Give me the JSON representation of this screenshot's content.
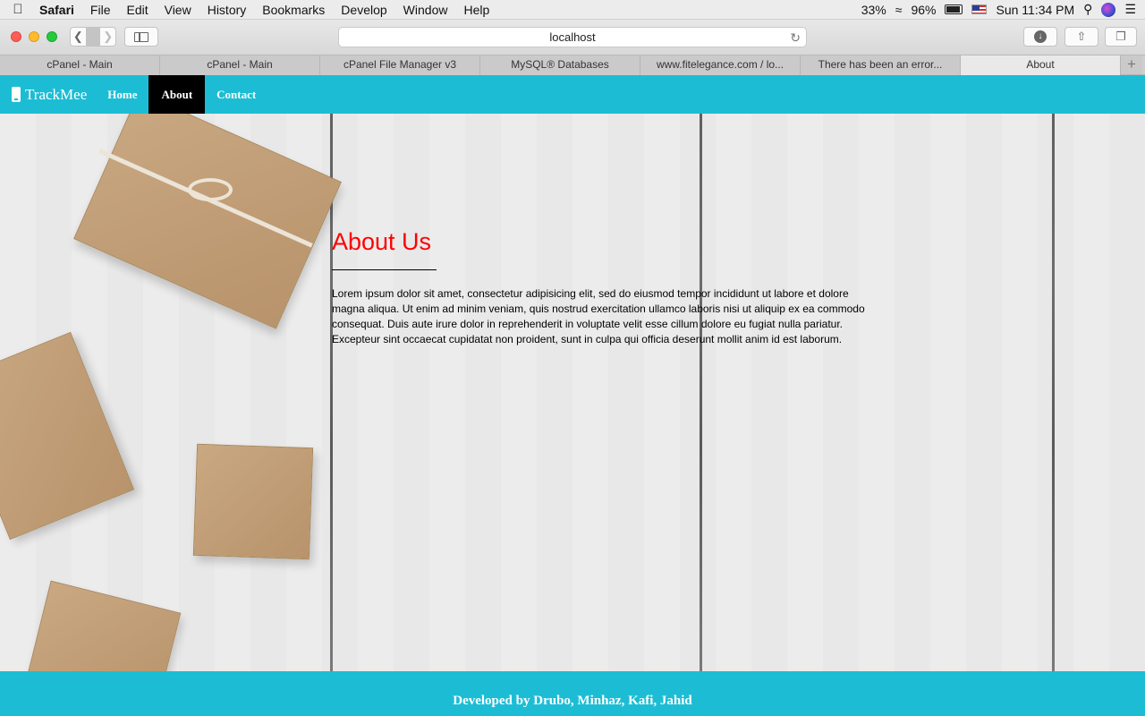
{
  "menubar": {
    "app": "Safari",
    "items": [
      "File",
      "Edit",
      "View",
      "History",
      "Bookmarks",
      "Develop",
      "Window",
      "Help"
    ],
    "cpu": "33%",
    "battery": "96%",
    "clock": "Sun 11:34 PM"
  },
  "browser": {
    "url": "localhost",
    "tabs": [
      {
        "label": "cPanel - Main"
      },
      {
        "label": "cPanel - Main"
      },
      {
        "label": "cPanel File Manager v3"
      },
      {
        "label": "MySQL® Databases"
      },
      {
        "label": "www.fitelegance.com / lo..."
      },
      {
        "label": "There has been an error..."
      },
      {
        "label": "About"
      }
    ]
  },
  "site": {
    "brand": "TrackMee",
    "nav": [
      {
        "label": "Home"
      },
      {
        "label": "About"
      },
      {
        "label": "Contact"
      }
    ],
    "about_title": "About Us",
    "about_body": "Lorem ipsum dolor sit amet, consectetur adipisicing elit, sed do eiusmod tempor incididunt ut labore et dolore magna aliqua. Ut enim ad minim veniam, quis nostrud exercitation ullamco laboris nisi ut aliquip ex ea commodo consequat. Duis aute irure dolor in reprehenderit in voluptate velit esse cillum dolore eu fugiat nulla pariatur. Excepteur sint occaecat cupidatat non proident, sunt in culpa qui officia deserunt mollit anim id est laborum.",
    "footer": "Developed by Drubo, Minhaz, Kafi, Jahid"
  },
  "colors": {
    "nav_bg": "#1cbdd4",
    "title": "#ff0000",
    "active_nav": "#000000"
  }
}
